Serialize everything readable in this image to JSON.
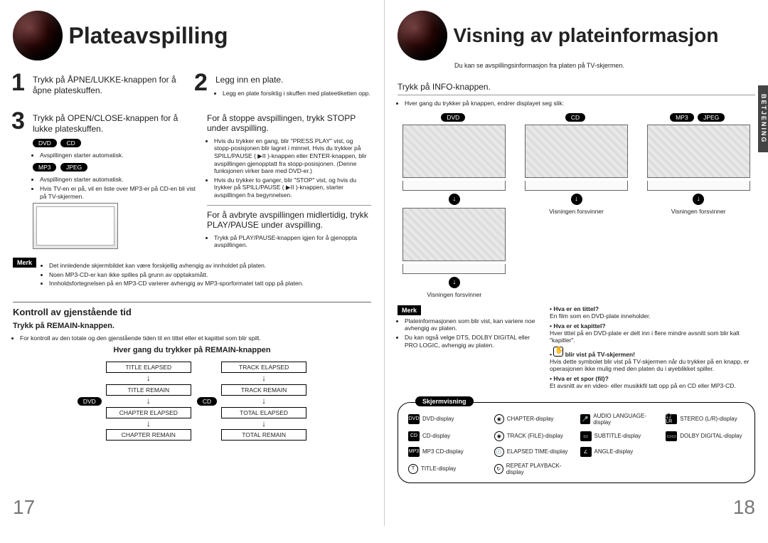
{
  "left": {
    "title": "Plateavspilling",
    "step1_head": "Trykk på ÅPNE/LUKKE-knappen for å åpne plateskuffen.",
    "step2_head": "Legg inn en plate.",
    "step2_note": "Legg en plate forsiktig i skuffen med plateetiketten opp.",
    "step3_head": "Trykk på OPEN/CLOSE-knappen for å lukke plateskuffen.",
    "pills_a": [
      "DVD",
      "CD"
    ],
    "note_a": "Avspillingen starter automatisk.",
    "pills_b": [
      "MP3",
      "JPEG"
    ],
    "note_b1": "Avspillingen starter automatisk.",
    "note_b2": "Hvis TV-en er på, vil en liste over MP3-er på CD-en bli vist på TV-skjermen.",
    "stop_head": "For å stoppe avspillingen, trykk STOPP under avspilling.",
    "stop_bullets": [
      "Hvis du trykker en gang, blir \"PRESS PLAY\" vist, og stopp-posisjonen blir lagret i minnet. Hvis du trykker på SPILL/PAUSE ( ▶ⅠⅠ )-knappen eller ENTER-knappen, blir avspillingen gjenopptatt fra stopp-posisjonen. (Denne funksjonen virker bare med DVD-er.)",
      "Hvis du trykker to ganger, blir \"STOP\" vist, og hvis du trykker på SPILL/PAUSE ( ▶ⅠⅠ )-knappen, starter avspillingen fra begynnelsen."
    ],
    "pause_head": "For å avbryte avspillingen midlertidig, trykk PLAY/PAUSE under avspilling.",
    "pause_bullet": "Trykk på PLAY/PAUSE-knappen igjen for å gjenoppta avspillingen.",
    "merk": "Merk",
    "merk_bullets": [
      "Det innledende skjermbildet kan være forskjellig avhengig av innholdet på platen.",
      "Noen MP3-CD-er kan ikke spilles på grunn av opptaksmått.",
      "Innholdsfortegnelsen på en MP3-CD varierer avhengig av MP3-sporformatet tatt opp på platen."
    ],
    "kontroll_head": "Kontroll av gjenstående tid",
    "remain_head": "Trykk på REMAIN-knappen.",
    "remain_note": "For kontroll av den totale og den gjenstående tiden til en tittel eller et kapittel som blir spilt.",
    "remain_sub": "Hver gang du trykker på REMAIN-knappen",
    "remain_dvd": [
      "TITLE ELAPSED",
      "TITLE REMAIN",
      "CHAPTER ELAPSED",
      "CHAPTER REMAIN"
    ],
    "remain_cd": [
      "TRACK ELAPSED",
      "TRACK REMAIN",
      "TOTAL ELAPSED",
      "TOTAL REMAIN"
    ],
    "pill_dvd": "DVD",
    "pill_cd": "CD",
    "pagenum": "17"
  },
  "right": {
    "title": "Visning av plateinformasjon",
    "subtitle": "Du kan se avspillingsinformasjon fra platen på TV-skjermen.",
    "info_head": "Trykk på INFO-knappen.",
    "info_note": "Hver gang du trykker på knappen, endrer displayet seg slik:",
    "col_pills": {
      "dvd": "DVD",
      "cd": "CD",
      "mp3": "MP3",
      "jpeg": "JPEG"
    },
    "col_caption": "Visningen forsvinner",
    "merk": "Merk",
    "merk_bullets": [
      "Plateinformasjonen som blir vist, kan variere noe avhengig av platen.",
      "Du kan også velge DTS, DOLBY DIGITAL eller PRO LOGIC, avhengig av platen."
    ],
    "qa": [
      {
        "q": "Hva er en tittel?",
        "a": "En film som en DVD-plate inneholder."
      },
      {
        "q": "Hva er et kapittel?",
        "a": "Hver tittel på en DVD-plate er delt inn i flere mindre avsnitt som blir kalt \"kapitler\"."
      },
      {
        "q": "blir vist på TV-skjermen!",
        "a": "Hvis dette symbolet blir vist på TV-skjermen når du trykker på en knapp, er operasjonen ikke mulig med den platen du i øyeblikket spiller.",
        "hand": true
      },
      {
        "q": "Hva er et spor (fil)?",
        "a": "Et avsnitt av en video- eller musikkfil tatt opp på en CD eller MP3-CD."
      }
    ],
    "panel_tab": "Skjermvisning",
    "panel_items": [
      {
        "icon": "DVD",
        "label": "DVD-display"
      },
      {
        "icon": "◉",
        "label": "CHAPTER-display",
        "circ": true
      },
      {
        "icon": "🎤",
        "label": "AUDIO LANGUAGE-display"
      },
      {
        "icon": "🎧 LR",
        "label": "STEREO (L/R)-display"
      },
      {
        "icon": "CD",
        "label": "CD-display"
      },
      {
        "icon": "◉",
        "label": "TRACK (FILE)-display",
        "circ": true
      },
      {
        "icon": "▭",
        "label": "SUBTITLE-display"
      },
      {
        "icon": "▭▭",
        "label": "DOLBY DIGITAL-display"
      },
      {
        "icon": "MP3",
        "label": "MP3 CD-display"
      },
      {
        "icon": "🕘",
        "label": "ELAPSED TIME-display",
        "circ": true
      },
      {
        "icon": "∠",
        "label": "ANGLE-display"
      },
      {
        "icon": "",
        "label": ""
      },
      {
        "icon": "T",
        "label": "TITLE-display",
        "circ": true
      },
      {
        "icon": "↻",
        "label": "REPEAT PLAYBACK-display",
        "circ": true
      },
      {
        "icon": "",
        "label": ""
      },
      {
        "icon": "",
        "label": ""
      }
    ],
    "side_tab": "BETJENING",
    "pagenum": "18"
  }
}
